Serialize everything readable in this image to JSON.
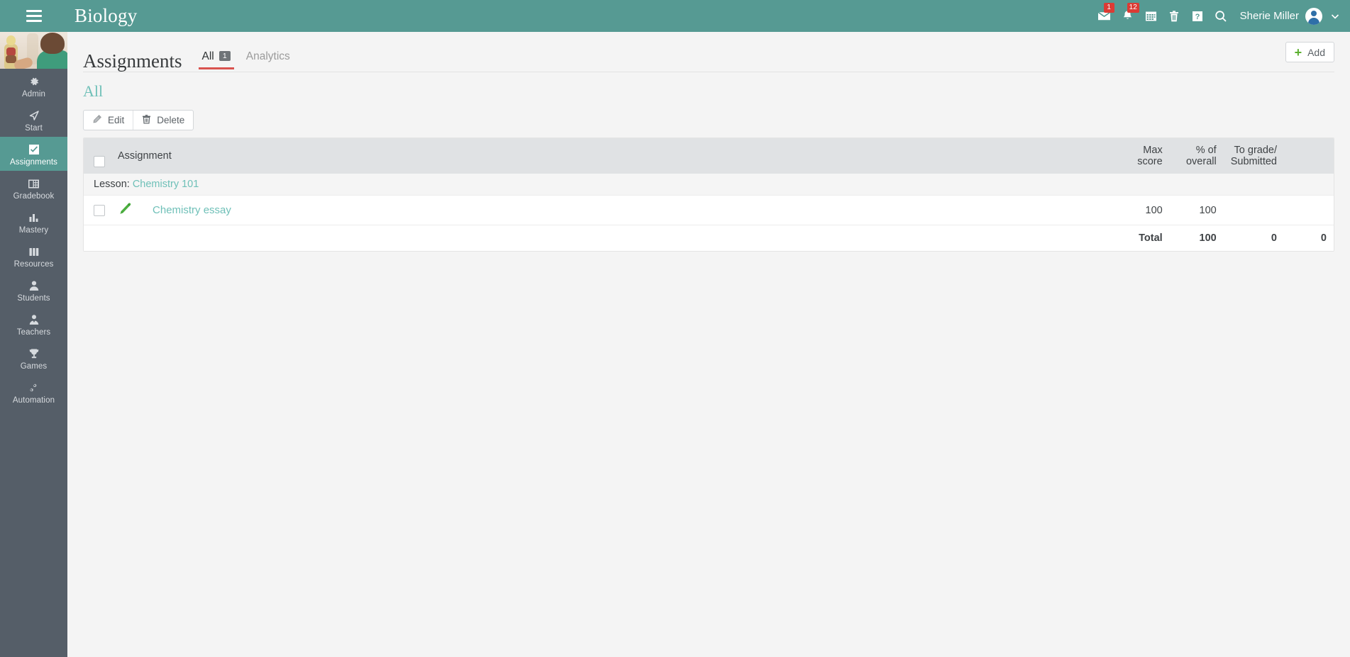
{
  "topbar": {
    "menu_icon": "hamburger-icon",
    "title": "Biology",
    "icons": [
      {
        "name": "messages-icon",
        "glyph": "envelope",
        "badge": "1"
      },
      {
        "name": "notifications-icon",
        "glyph": "bell",
        "badge": "12"
      },
      {
        "name": "calendar-icon",
        "glyph": "calendar",
        "badge": ""
      },
      {
        "name": "trash-icon",
        "glyph": "trash",
        "badge": ""
      },
      {
        "name": "help-icon",
        "glyph": "question",
        "badge": ""
      },
      {
        "name": "search-icon",
        "glyph": "magnifier",
        "badge": ""
      }
    ],
    "user_name": "Sherie Miller",
    "avatar_icon": "user-avatar",
    "caret_icon": "chevron-down-icon"
  },
  "sidebar": {
    "photo_alt": "biology-classroom-photo",
    "items": [
      {
        "label": "Admin",
        "icon": "gear-icon",
        "active": false
      },
      {
        "label": "Start",
        "icon": "navigation-arrow-icon",
        "active": false
      },
      {
        "label": "Assignments",
        "icon": "checked-box-icon",
        "active": true
      },
      {
        "label": "Gradebook",
        "icon": "gradebook-icon",
        "active": false
      },
      {
        "label": "Mastery",
        "icon": "bar-chart-icon",
        "active": false
      },
      {
        "label": "Resources",
        "icon": "books-icon",
        "active": false
      },
      {
        "label": "Students",
        "icon": "person-icon",
        "active": false
      },
      {
        "label": "Teachers",
        "icon": "teacher-icon",
        "active": false
      },
      {
        "label": "Games",
        "icon": "trophy-icon",
        "active": false
      },
      {
        "label": "Automation",
        "icon": "gears-icon",
        "active": false
      }
    ]
  },
  "page": {
    "title": "Assignments",
    "tabs": [
      {
        "label": "All",
        "badge": "1",
        "active": true
      },
      {
        "label": "Analytics",
        "badge": "",
        "active": false
      }
    ],
    "add_label": "Add",
    "add_icon": "plus-icon",
    "section_title": "All"
  },
  "toolbar": {
    "edit_label": "Edit",
    "edit_icon": "pencil-icon",
    "delete_label": "Delete",
    "delete_icon": "trash-icon"
  },
  "table": {
    "headers": {
      "assignment": "Assignment",
      "max_score": "Max\nscore",
      "percent_overall": "% of\noverall",
      "to_grade_submitted": "To grade/\nSubmitted"
    },
    "lesson_label": "Lesson:",
    "lesson_name": "Chemistry 101",
    "rows": [
      {
        "name": "Chemistry essay",
        "icon": "green-pencil-icon",
        "max_score": "100",
        "percent_overall": "100",
        "to_grade": "",
        "submitted": ""
      }
    ],
    "total": {
      "label": "Total",
      "max_score": "100",
      "percent_overall": "0",
      "to_grade": "0"
    }
  }
}
